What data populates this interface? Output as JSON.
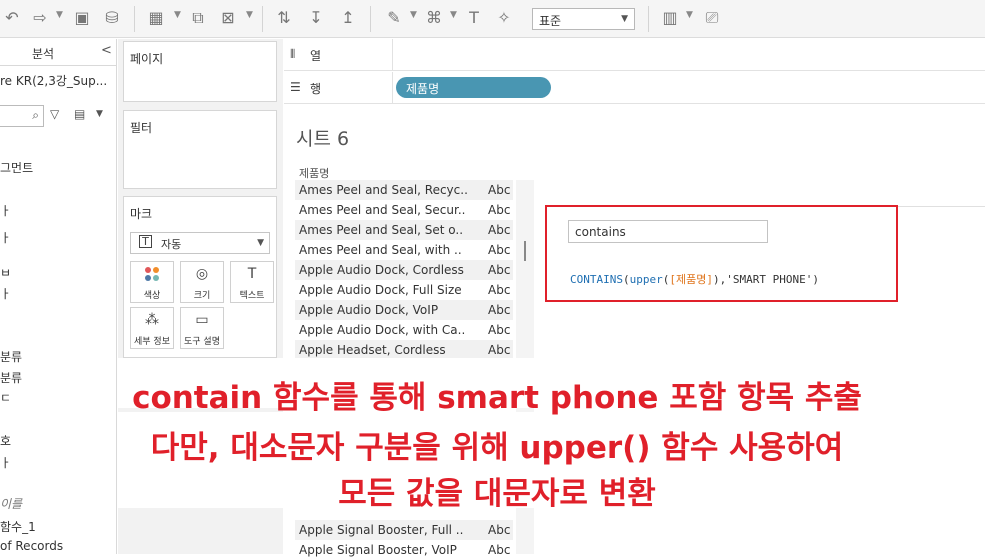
{
  "toolbar": {
    "fit_value": "표준"
  },
  "data_pane": {
    "tab_label": "분석",
    "collapse_glyph": "<",
    "data_source": "re  KR(2,3강_Sup...",
    "fragments": [
      "그먼트",
      "ㅏ",
      "ㅏ",
      "ㅂ",
      "ㅏ",
      "분류",
      "분류",
      "ㄷ",
      "호",
      "ㅏ"
    ],
    "section_label": "이를",
    "calc_field": "함수_1",
    "records_field": "of Records"
  },
  "cards": {
    "pages": "페이지",
    "filters": "필터",
    "marks": "마크",
    "mark_type": "자동",
    "mark_buttons": [
      "색상",
      "크기",
      "텍스트",
      "세부 정보",
      "도구 설명"
    ]
  },
  "shelves": {
    "columns_label": "열",
    "rows_label": "행",
    "rows_pill": "제품명"
  },
  "sheet": {
    "title": "시트 6",
    "column_header": "제품명",
    "rows": [
      {
        "name": "Ames Peel and Seal, Recyc..",
        "val": "Abc"
      },
      {
        "name": "Ames Peel and Seal, Secur..",
        "val": "Abc"
      },
      {
        "name": "Ames Peel and Seal, Set o..",
        "val": "Abc"
      },
      {
        "name": "Ames Peel and Seal, with ..",
        "val": "Abc"
      },
      {
        "name": "Apple Audio Dock, Cordless",
        "val": "Abc"
      },
      {
        "name": "Apple Audio Dock, Full Size",
        "val": "Abc"
      },
      {
        "name": "Apple Audio Dock, VoIP",
        "val": "Abc"
      },
      {
        "name": "Apple Audio Dock, with Ca..",
        "val": "Abc"
      },
      {
        "name": "Apple Headset, Cordless",
        "val": "Abc"
      }
    ],
    "bottom_rows": [
      {
        "name": "Apple Signal Booster, Full ..",
        "val": "Abc"
      },
      {
        "name": "Apple Signal Booster, VoIP",
        "val": "Abc"
      }
    ]
  },
  "calc": {
    "name": "contains",
    "fn1": "CONTAINS",
    "fn2": "upper",
    "field": "[제품명]",
    "string": "'SMART PHONE'"
  },
  "annotation": {
    "line1": "contain 함수를 통해 smart phone 포함 항목 추출",
    "line2": "다만, 대소문자 구분을 위해 upper() 함수 사용하여",
    "line3": "모든 값을 대문자로 변환",
    "color": "#e0202a"
  }
}
